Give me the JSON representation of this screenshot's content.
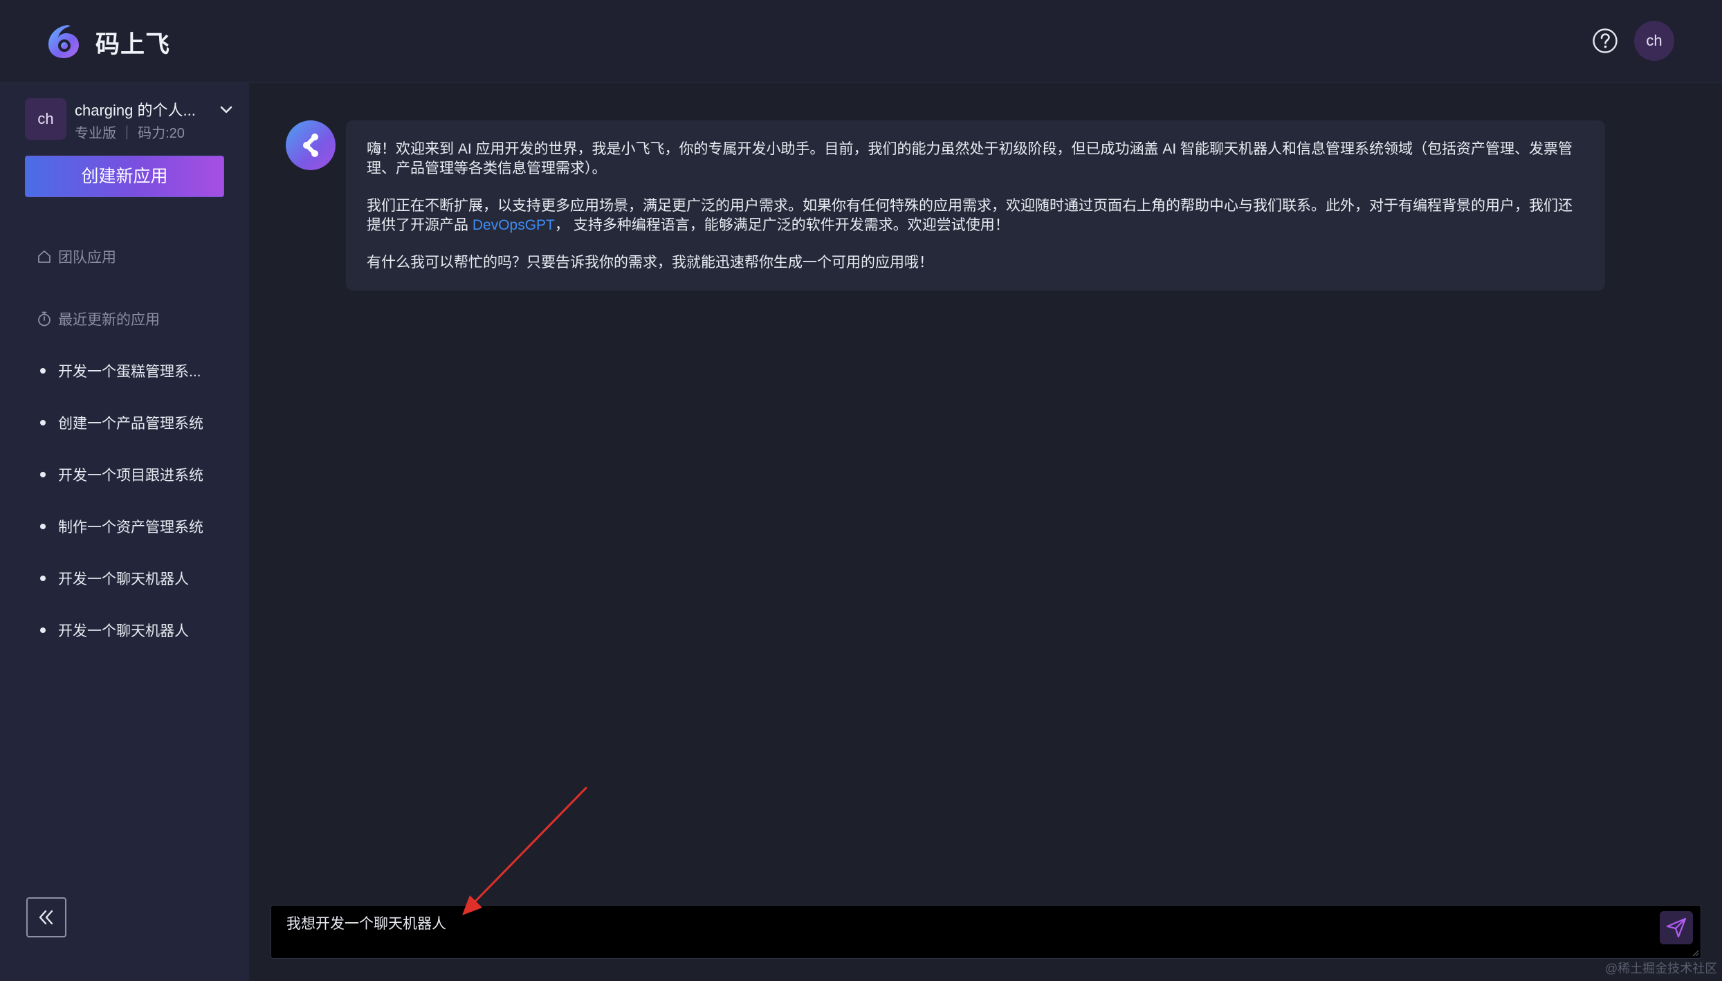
{
  "header": {
    "app_title": "码上飞",
    "logo_icon": "app-logo-icon",
    "help_icon": "question-circle-icon",
    "user_initials": "ch"
  },
  "sidebar": {
    "workspace": {
      "initials": "ch",
      "name": "charging 的个人...",
      "meta": "专业版 ｜ 码力:20"
    },
    "create_button": "创建新应用",
    "team_apps_label": "团队应用",
    "recent_label": "最近更新的应用",
    "recent_items": [
      "开发一个蛋糕管理系...",
      "创建一个产品管理系统",
      "开发一个项目跟进系统",
      "制作一个资产管理系统",
      "开发一个聊天机器人",
      "开发一个聊天机器人"
    ]
  },
  "chat": {
    "welcome_p1": "嗨！欢迎来到 AI 应用开发的世界，我是小飞飞，你的专属开发小助手。目前，我们的能力虽然处于初级阶段，但已成功涵盖 AI 智能聊天机器人和信息管理系统领域（包括资产管理、发票管理、产品管理等各类信息管理需求）。",
    "welcome_p2_before": "我们正在不断扩展，以支持更多应用场景，满足更广泛的用户需求。如果你有任何特殊的应用需求，欢迎随时通过页面右上角的帮助中心与我们联系。此外，对于有编程背景的用户，我们还提供了开源产品 ",
    "welcome_p2_link": "DevOpsGPT",
    "welcome_p2_after": "， 支持多种编程语言，能够满足广泛的软件开发需求。欢迎尝试使用！",
    "welcome_p3": "有什么我可以帮忙的吗？只要告诉我你的需求，我就能迅速帮你生成一个可用的应用哦！"
  },
  "input": {
    "value": "我想开发一个聊天机器人"
  },
  "watermark": "@稀土掘金技术社区",
  "colors": {
    "background": "#1d1f2b",
    "sidebar": "#23263a",
    "accent_gradient_start": "#4b6de6",
    "accent_gradient_end": "#a64fe3",
    "link": "#3f8df5",
    "annotation_arrow": "#e0302a"
  }
}
